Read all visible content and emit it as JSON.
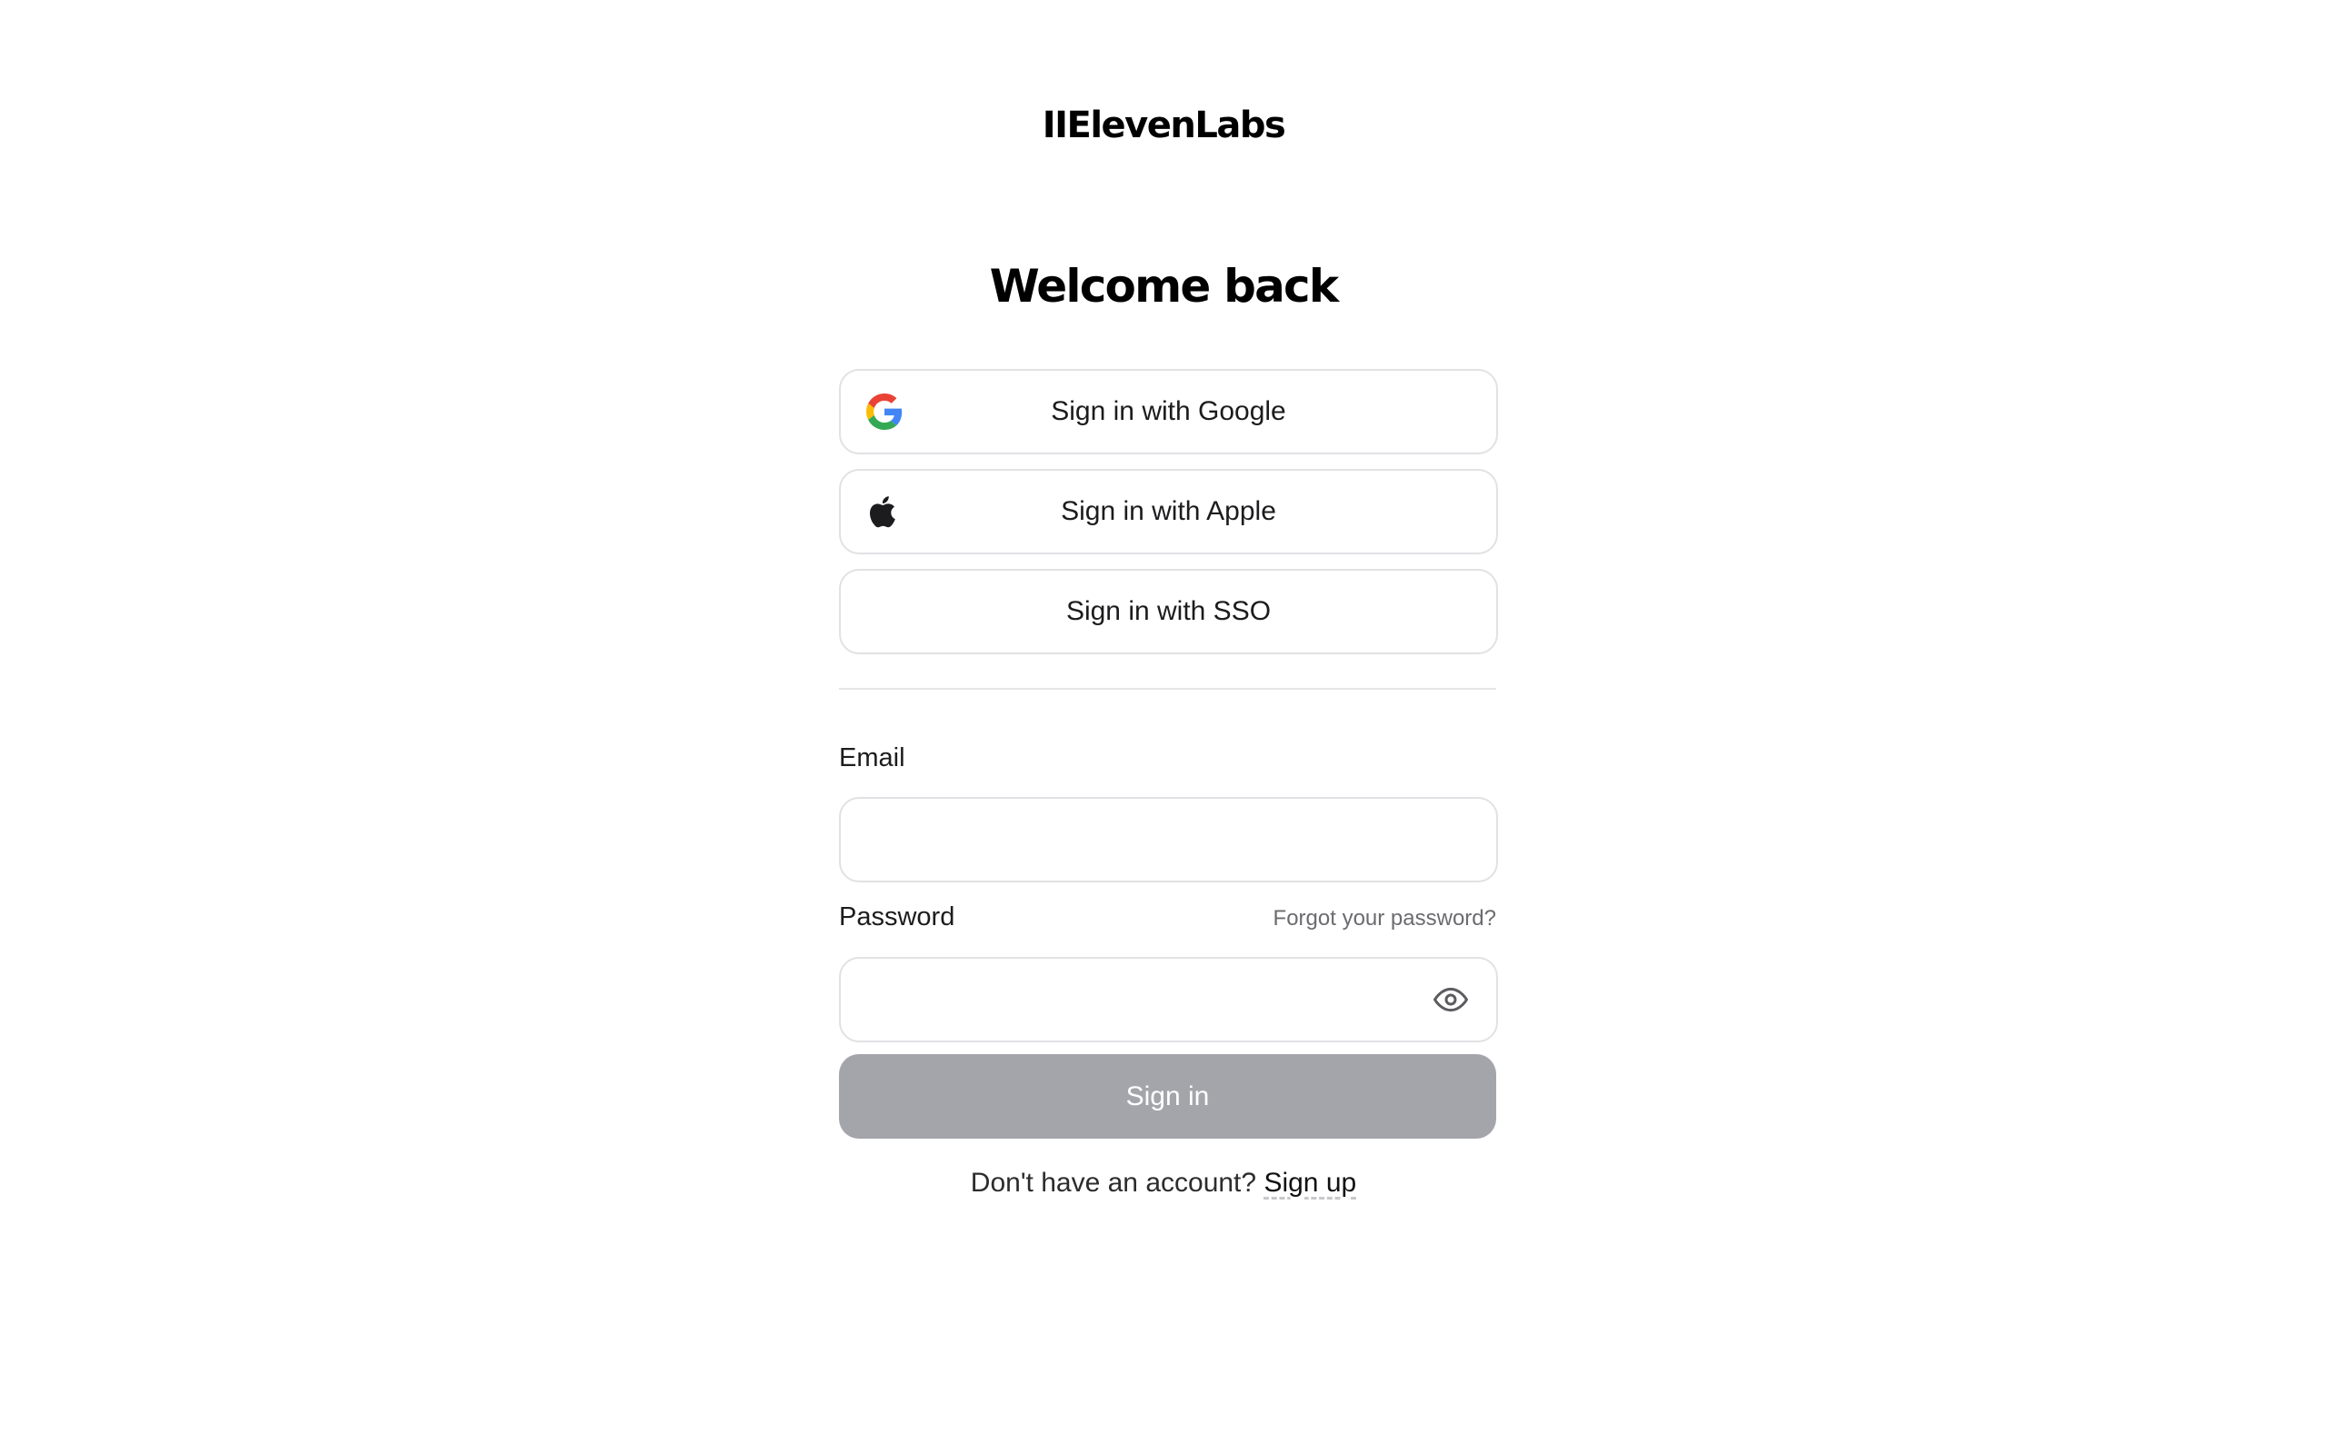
{
  "brand": {
    "logo_text": "IIElevenLabs"
  },
  "page": {
    "heading": "Welcome back"
  },
  "oauth": {
    "google_label": "Sign in with Google",
    "apple_label": "Sign in with Apple",
    "sso_label": "Sign in with SSO"
  },
  "form": {
    "email_label": "Email",
    "email_value": "",
    "password_label": "Password",
    "password_value": "",
    "forgot_label": "Forgot your password?",
    "submit_label": "Sign in"
  },
  "footer": {
    "prompt": "Don't have an account?",
    "signup_label": "Sign up"
  },
  "icons": {
    "google": "google-icon",
    "apple": "apple-icon",
    "eye": "eye-icon"
  },
  "colors": {
    "submit_disabled": "#a4a5ab",
    "border": "#e2e2e5",
    "muted_text": "#6b6b70"
  }
}
